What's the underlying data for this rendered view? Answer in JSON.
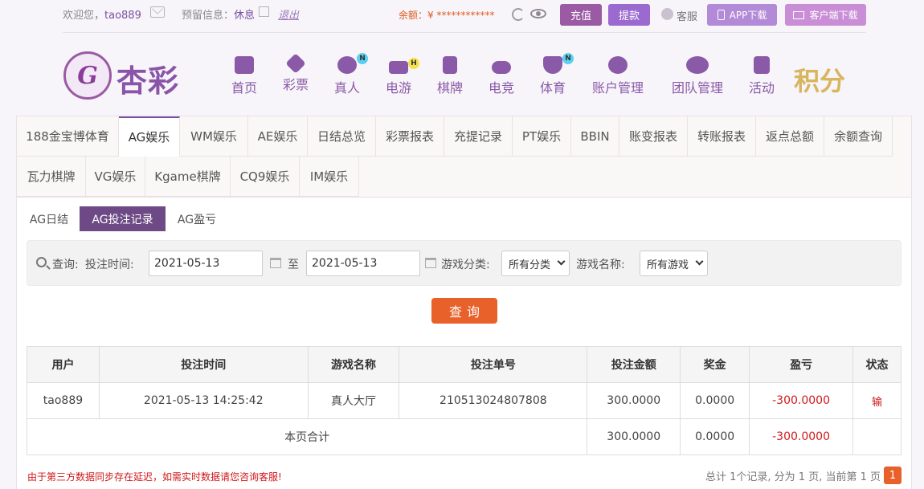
{
  "topbar": {
    "welcome_label": "欢迎您，",
    "username": "tao889",
    "reserve_label": "预留信息：",
    "reserve_value": "休息",
    "logout": "退出",
    "balance_label": "余额：",
    "balance_value": "¥ ************",
    "recharge": "充值",
    "withdraw": "提款",
    "service": "客服",
    "app_download": "APP下载",
    "client_download": "客户端下载"
  },
  "logo": {
    "text": "杏彩"
  },
  "nav": [
    {
      "label": "首页",
      "icon": "home-icon",
      "badge": ""
    },
    {
      "label": "彩票",
      "icon": "lottery-icon",
      "badge": ""
    },
    {
      "label": "真人",
      "icon": "live-icon",
      "badge": "N"
    },
    {
      "label": "电游",
      "icon": "gamepad-icon",
      "badge": "H"
    },
    {
      "label": "棋牌",
      "icon": "cards-icon",
      "badge": ""
    },
    {
      "label": "电竞",
      "icon": "esports-icon",
      "badge": ""
    },
    {
      "label": "体育",
      "icon": "trophy-icon",
      "badge": "N"
    },
    {
      "label": "账户管理",
      "icon": "account-icon",
      "badge": ""
    },
    {
      "label": "团队管理",
      "icon": "team-icon",
      "badge": ""
    },
    {
      "label": "活动",
      "icon": "gift-icon",
      "badge": ""
    }
  ],
  "jifen": "积分",
  "tabs_row1": [
    "188金宝博体育",
    "AG娱乐",
    "WM娱乐",
    "AE娱乐",
    "日结总览",
    "彩票报表",
    "充提记录",
    "PT娱乐",
    "BBIN",
    "账变报表",
    "转账报表",
    "返点总额",
    "余额查询"
  ],
  "tabs_row2": [
    "瓦力棋牌",
    "VG娱乐",
    "Kgame棋牌",
    "CQ9娱乐",
    "IM娱乐"
  ],
  "active_tab": "AG娱乐",
  "subtabs": [
    "AG日结",
    "AG投注记录",
    "AG盈亏"
  ],
  "filter": {
    "query_label": "查询:",
    "time_label": "投注时间:",
    "date_from": "2021-05-13",
    "to_label": "至",
    "date_to": "2021-05-13",
    "category_label": "游戏分类:",
    "category_value": "所有分类",
    "name_label": "游戏名称:",
    "name_value": "所有游戏"
  },
  "query_button": "查询",
  "table": {
    "headers": [
      "用户",
      "投注时间",
      "游戏名称",
      "投注单号",
      "投注金额",
      "奖金",
      "盈亏",
      "状态"
    ],
    "rows": [
      [
        "tao889",
        "2021-05-13 14:25:42",
        "真人大厅",
        "210513024807808",
        "300.0000",
        "0.0000",
        "-300.0000",
        "输"
      ]
    ],
    "summary": {
      "label": "本页合计",
      "amount": "300.0000",
      "bonus": "0.0000",
      "profit": "-300.0000"
    }
  },
  "note": "由于第三方数据同步存在延迟，如需实时数据请您咨询客服!",
  "pager": {
    "text": "总计 1个记录, 分为 1 页, 当前第 1 页",
    "page": "1"
  },
  "colors": {
    "brand": "#7b4fa0",
    "accent": "#e8602a",
    "negative": "#d0191c"
  }
}
